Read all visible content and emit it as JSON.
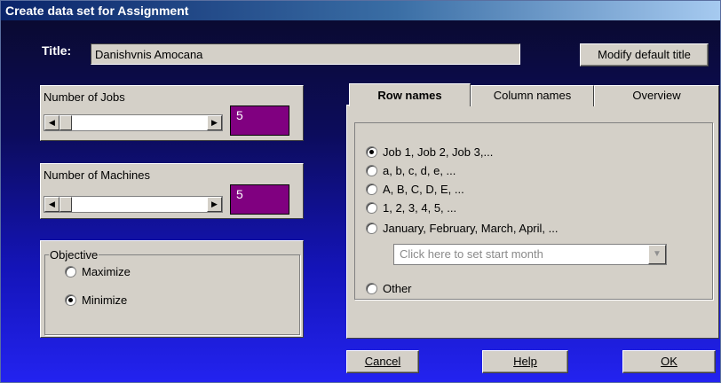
{
  "window": {
    "title": "Create data set for Assignment"
  },
  "title_field": {
    "label": "Title:",
    "value": "Danishvnis Amocana"
  },
  "buttons": {
    "modify_default_title": "Modify default title",
    "cancel": "Cancel",
    "help": "Help",
    "ok": "OK"
  },
  "jobs": {
    "label": "Number of Jobs",
    "value": "5"
  },
  "machines": {
    "label": "Number of Machines",
    "value": "5"
  },
  "objective": {
    "legend": "Objective",
    "options": [
      {
        "label": "Maximize",
        "selected": false
      },
      {
        "label": "Minimize",
        "selected": true
      }
    ]
  },
  "tabs": [
    {
      "label": "Row names",
      "active": true
    },
    {
      "label": "Column names",
      "active": false
    },
    {
      "label": "Overview",
      "active": false
    }
  ],
  "row_names": {
    "options": [
      {
        "label": "Job 1, Job 2, Job 3,...",
        "selected": true
      },
      {
        "label": "a, b, c, d, e, ...",
        "selected": false
      },
      {
        "label": "A, B, C, D, E, ...",
        "selected": false
      },
      {
        "label": "1, 2, 3, 4, 5, ...",
        "selected": false
      },
      {
        "label": "January, February, March, April, ...",
        "selected": false
      },
      {
        "label": "Other",
        "selected": false
      }
    ],
    "month_placeholder": "Click here to set start month"
  },
  "colors": {
    "value_box": "#800080",
    "panel": "#d4d0c8",
    "titlebar": "#0a246a"
  }
}
